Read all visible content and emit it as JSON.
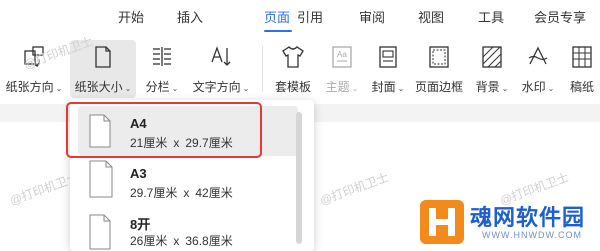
{
  "menu": {
    "items": [
      "开始",
      "插入",
      "页面",
      "引用",
      "审阅",
      "视图",
      "工具",
      "会员专享"
    ],
    "active_index": 2,
    "accent_color": "#2f6fe9"
  },
  "ribbon": {
    "tools": [
      {
        "label": "纸张方向",
        "icon": "page-orientation-icon",
        "has_dropdown": true
      },
      {
        "label": "纸张大小",
        "icon": "page-size-icon",
        "has_dropdown": true,
        "selected": true
      },
      {
        "label": "分栏",
        "icon": "columns-icon",
        "has_dropdown": true
      },
      {
        "label": "文字方向",
        "icon": "text-direction-icon",
        "has_dropdown": true
      },
      {
        "label": "套模板",
        "icon": "template-shirt-icon",
        "has_dropdown": false
      },
      {
        "label": "主题",
        "icon": "theme-icon",
        "has_dropdown": true,
        "disabled": true
      },
      {
        "label": "封面",
        "icon": "cover-icon",
        "has_dropdown": true
      },
      {
        "label": "页面边框",
        "icon": "page-border-icon",
        "has_dropdown": false
      },
      {
        "label": "背景",
        "icon": "background-icon",
        "has_dropdown": true
      },
      {
        "label": "水印",
        "icon": "watermark-icon",
        "has_dropdown": true
      },
      {
        "label": "稿纸",
        "icon": "manuscript-icon",
        "has_dropdown": false
      }
    ],
    "dropdown_caret": "⌄"
  },
  "paper_size_menu": {
    "items": [
      {
        "name": "A4",
        "width": "21厘米",
        "height": "29.7厘米",
        "selected": true
      },
      {
        "name": "A3",
        "width": "29.7厘米",
        "height": "42厘米"
      },
      {
        "name": "8开",
        "width": "26厘米",
        "height": "36.8厘米"
      }
    ],
    "separator": "x",
    "highlight_color": "#e53935"
  },
  "watermarks": [
    "@打印机卫士",
    "@打印机卫士",
    "@打印机卫士",
    "@打印机卫士"
  ],
  "logo": {
    "title": "魂网软件园",
    "subtitle": "WWW.HNWDW.COM"
  }
}
